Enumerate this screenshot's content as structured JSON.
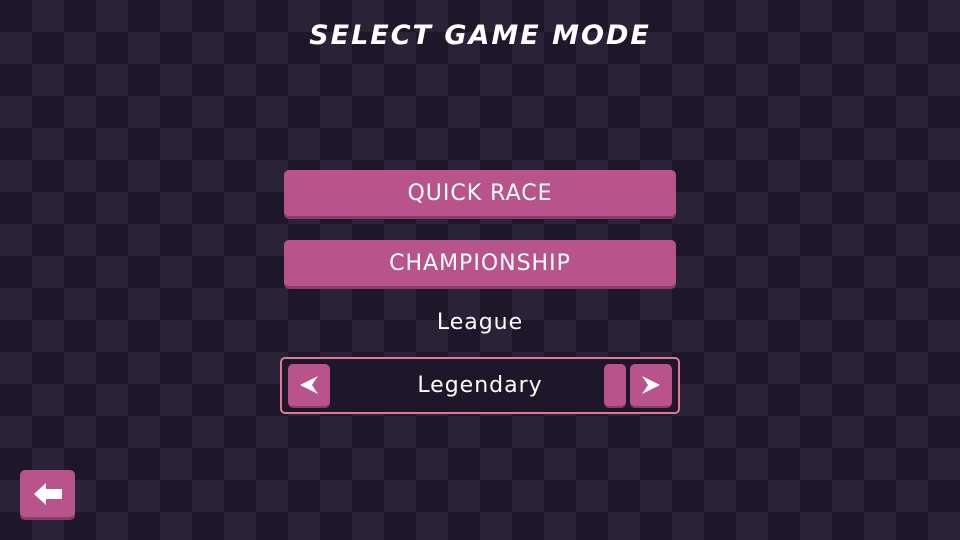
{
  "title": "SELECT GAME MODE",
  "menu": {
    "quick_race_label": "QUICK RACE",
    "championship_label": "CHAMPIONSHIP"
  },
  "league": {
    "label": "League",
    "selected_value": "Legendary"
  },
  "icons": {
    "prev": "arrow-left-icon",
    "next": "arrow-right-icon",
    "back": "back-arrow-icon"
  },
  "colors": {
    "accent": "#b8548b",
    "accent_shadow": "#8b3b69",
    "selector_border": "#e07a8f",
    "background_dark": "#1e1629",
    "background_light": "#2a2338",
    "text": "#ffffff"
  }
}
